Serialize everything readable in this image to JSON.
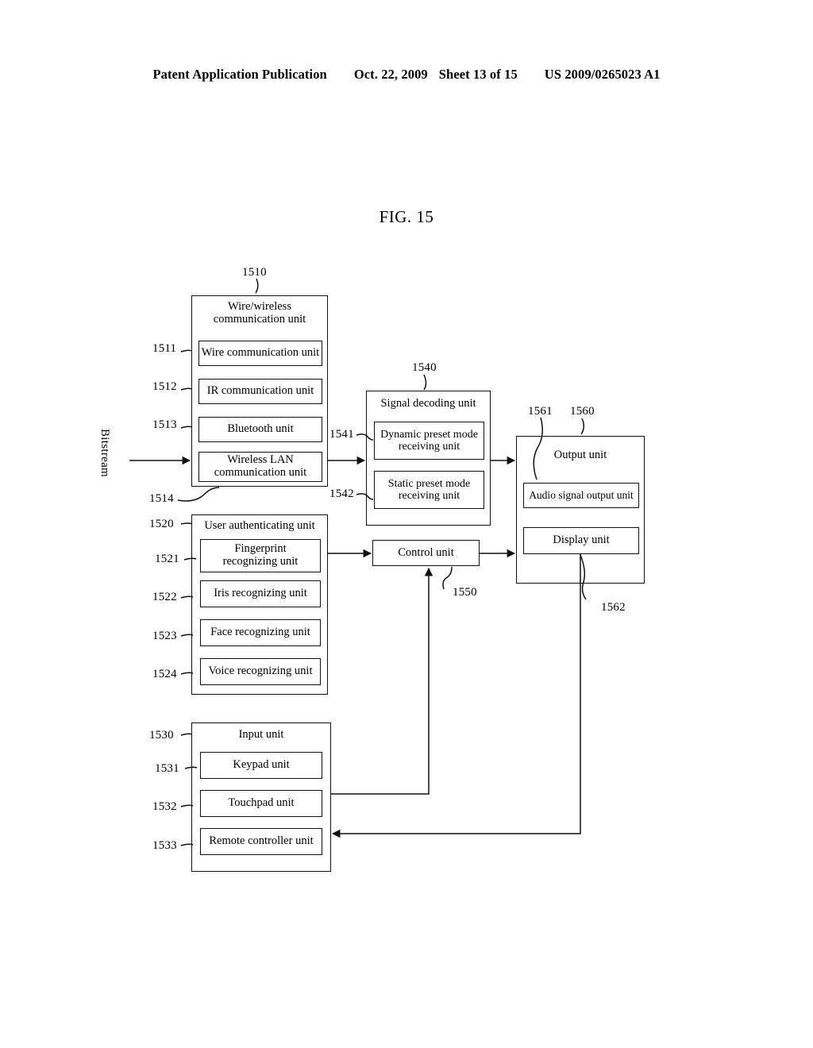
{
  "header": {
    "publication": "Patent Application Publication",
    "date": "Oct. 22, 2009",
    "sheet": "Sheet 13 of 15",
    "patent_number": "US 2009/0265023 A1"
  },
  "figure": {
    "title": "FIG. 15",
    "input_signal_label": "Bitstream"
  },
  "blocks": {
    "comm": {
      "ref": "1510",
      "title": "Wire/wireless\ncommunication unit",
      "title_line1": "Wire/wireless",
      "title_line2": "communication unit",
      "children": [
        {
          "ref": "1511",
          "label": "Wire communication unit"
        },
        {
          "ref": "1512",
          "label": "IR communication unit"
        },
        {
          "ref": "1513",
          "label": "Bluetooth unit"
        },
        {
          "ref": "1514",
          "label": "Wireless LAN\ncommunication unit",
          "line1": "Wireless LAN",
          "line2": "communication unit"
        }
      ]
    },
    "auth": {
      "ref": "1520",
      "title": "User authenticating unit",
      "children": [
        {
          "ref": "1521",
          "label": "Fingerprint\nrecognizing unit",
          "line1": "Fingerprint",
          "line2": "recognizing unit"
        },
        {
          "ref": "1522",
          "label": "Iris recognizing unit"
        },
        {
          "ref": "1523",
          "label": "Face recognizing unit"
        },
        {
          "ref": "1524",
          "label": "Voice recognizing unit"
        }
      ]
    },
    "input": {
      "ref": "1530",
      "title": "Input unit",
      "children": [
        {
          "ref": "1531",
          "label": "Keypad unit"
        },
        {
          "ref": "1532",
          "label": "Touchpad unit"
        },
        {
          "ref": "1533",
          "label": "Remote controller unit"
        }
      ]
    },
    "decoding": {
      "ref": "1540",
      "title": "Signal decoding unit",
      "children": [
        {
          "ref": "1541",
          "label": "Dynamic preset mode\nreceiving unit",
          "line1": "Dynamic preset mode",
          "line2": "receiving unit"
        },
        {
          "ref": "1542",
          "label": "Static preset mode\nreceiving unit",
          "line1": "Static preset mode",
          "line2": "receiving unit"
        }
      ]
    },
    "control": {
      "ref": "1550",
      "title": "Control unit"
    },
    "output": {
      "ref": "1560",
      "title": "Output unit",
      "children": [
        {
          "ref": "1561",
          "label": "Audio signal output unit"
        },
        {
          "ref": "1562",
          "label": "Display unit"
        }
      ]
    }
  }
}
